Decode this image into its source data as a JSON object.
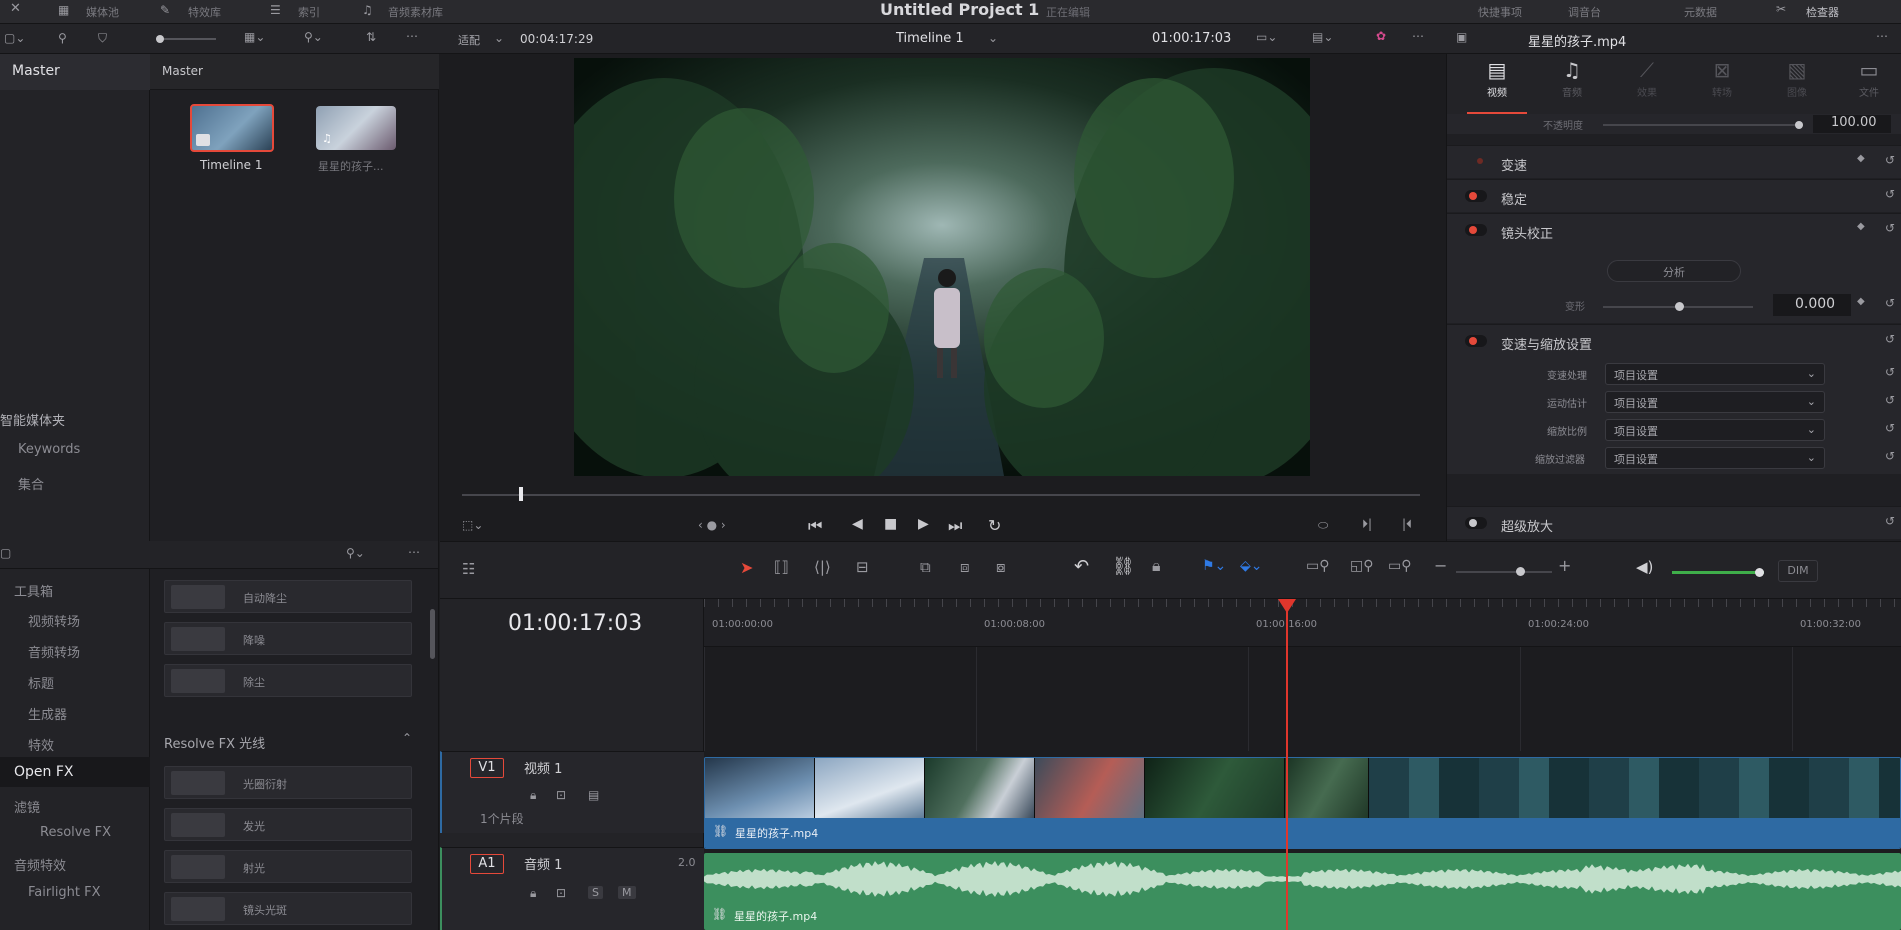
{
  "menubar": {
    "items": [
      "媒体池",
      "特效库",
      "索引",
      "音频素材库"
    ],
    "project_title": "Untitled Project 1",
    "project_status": "正在编辑",
    "right_items": [
      "快捷事项",
      "调音台",
      "元数据",
      "检查器"
    ]
  },
  "mediapool": {
    "header_left": "Master",
    "header_right": "Master",
    "clips": [
      {
        "label": "Timeline 1"
      },
      {
        "label": "星星的孩子..."
      }
    ],
    "smart_bins_title": "智能媒体夹",
    "smart_bins": [
      "Keywords",
      "集合"
    ]
  },
  "viewer": {
    "fit_label": "适配",
    "duration": "00:04:17:29",
    "timeline_name": "Timeline 1",
    "timecode": "01:00:17:03",
    "playhead_pct": 0.06
  },
  "inspector": {
    "clip_name": "星星的孩子.mp4",
    "tabs": [
      {
        "label": "视频",
        "icon": "film-icon",
        "active": true
      },
      {
        "label": "音频",
        "icon": "music-note-icon",
        "active": false
      },
      {
        "label": "效果",
        "icon": "wand-icon",
        "active": false
      },
      {
        "label": "转场",
        "icon": "transition-icon",
        "active": false
      },
      {
        "label": "图像",
        "icon": "image-icon",
        "active": false
      },
      {
        "label": "文件",
        "icon": "file-icon",
        "active": false
      }
    ],
    "opacity_label": "不透明度",
    "opacity_value": "100.00",
    "sections": [
      {
        "label": "变速",
        "enabled": false
      },
      {
        "label": "稳定",
        "enabled": true
      },
      {
        "label": "镜头校正",
        "enabled": true
      }
    ],
    "analyze_label": "分析",
    "distortion_label": "变形",
    "distortion_value": "0.000",
    "retime_section": "变速与缩放设置",
    "retime_rows": [
      {
        "label": "变速处理",
        "value": "项目设置"
      },
      {
        "label": "运动估计",
        "value": "项目设置"
      },
      {
        "label": "缩放比例",
        "value": "项目设置"
      },
      {
        "label": "缩放过滤器",
        "value": "项目设置"
      }
    ],
    "superscale_label": "超级放大"
  },
  "effects": {
    "tree": [
      "工具箱",
      "视频转场",
      "音频转场",
      "标题",
      "生成器",
      "特效",
      "Open FX",
      "滤镜",
      "Resolve FX",
      "音频特效",
      "Fairlight FX"
    ],
    "tree_active": "Open FX",
    "top_items": [
      "自动降尘",
      "降噪",
      "除尘"
    ],
    "group_title": "Resolve FX 光线",
    "light_items": [
      "光圈衍射",
      "发光",
      "射光",
      "镜头光斑"
    ]
  },
  "timeline": {
    "timecode": "01:00:17:03",
    "ruler": [
      "01:00:00:00",
      "01:00:08:00",
      "01:00:16:00",
      "01:00:24:00",
      "01:00:32:00"
    ],
    "tracks": [
      {
        "id": "V1",
        "name": "视频 1",
        "info": "1个片段",
        "clip": "星星的孩子.mp4"
      },
      {
        "id": "A1",
        "name": "音频 1",
        "channels": "2.0",
        "clip": "星星的孩子.mp4"
      }
    ],
    "playhead_time": "01:00:16:00",
    "dim_label": "DIM"
  },
  "colors": {
    "accent_red": "#e5493a",
    "video_clip_bar": "#2e6aa3",
    "audio_clip": "#3c8f5e",
    "playhead": "#e0362c"
  }
}
